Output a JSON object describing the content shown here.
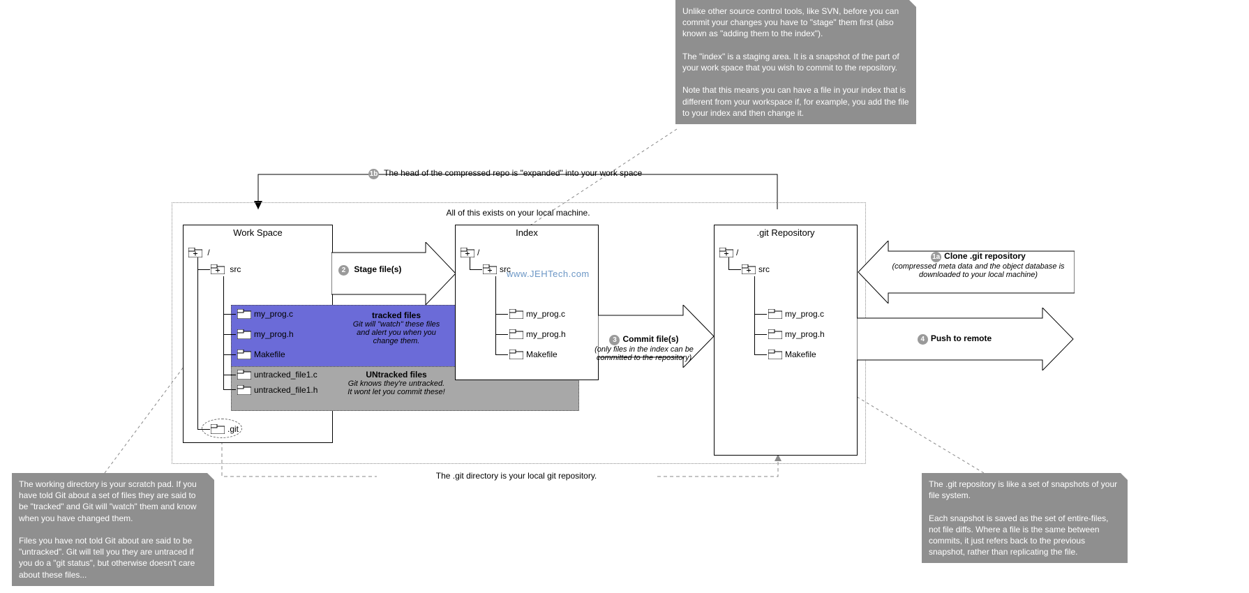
{
  "top_note": {
    "p1": "Unlike other source control tools, like SVN, before you can commit your changes you have to \"stage\" them first (also known as \"adding them to the index\").",
    "p2": "The \"index\" is a staging area. It is a snapshot of the part of your work space that you wish to commit to the repository.",
    "p3": "Note that this means you can have a file in your index that is different from your workspace if, for example, you add the file to your index and then change it."
  },
  "left_note": {
    "p1": "The working directory is your scratch pad. If you have told Git about a set of files they are said to be \"tracked\" and  Git will \"watch\" them and know when you have changed them.",
    "p2": "Files you have not told Git about are said to be \"untracked\". Git will tell you they are untraced if you do a \"git status\", but otherwise doesn't care about these files..."
  },
  "right_note": {
    "p1": "The .git repository is like a set of snapshots of your file system.",
    "p2": "Each snapshot is saved as the set of entire-files, not file diffs. Where a file is the same between commits, it just refers back to the previous snapshot, rather than replicating the file."
  },
  "outer_caption": "All of this exists on your local machine.",
  "step1b": {
    "num": "1b",
    "text": "The head of the compressed repo is \"expanded\" into your work space"
  },
  "watermark": "www.JEHTech.com",
  "panel_workspace": {
    "title": "Work Space",
    "root": "/",
    "src": "src",
    "files_tracked": [
      "my_prog.c",
      "my_prog.h",
      "Makefile"
    ],
    "files_untracked": [
      "untracked_file1.c",
      "untracked_file1.h"
    ],
    "git_folder": ".git"
  },
  "panel_index": {
    "title": "Index",
    "root": "/",
    "src": "src",
    "files": [
      "my_prog.c",
      "my_prog.h",
      "Makefile"
    ]
  },
  "panel_repo": {
    "title": ".git Repository",
    "root": "/",
    "src": "src",
    "files": [
      "my_prog.c",
      "my_prog.h",
      "Makefile"
    ]
  },
  "stage": {
    "num": "2",
    "label": "Stage file(s)"
  },
  "tracked_box": {
    "title": "tracked files",
    "desc": "Git will \"watch\" these files and alert you when you change them."
  },
  "untracked_box": {
    "title": "UNtracked files",
    "desc": "Git knows they're untracked. It wont let you commit these!"
  },
  "commit": {
    "num": "3",
    "label": "Commit file(s)",
    "desc": "(only files in the index can be committed to the repository)"
  },
  "clone": {
    "num": "1a",
    "label": "Clone .git repository",
    "desc": "(compressed meta data and the object database is downloaded to your local machine)"
  },
  "push": {
    "num": "4",
    "label": "Push to remote"
  },
  "git_dir_caption": "The .git directory is your local git repository."
}
